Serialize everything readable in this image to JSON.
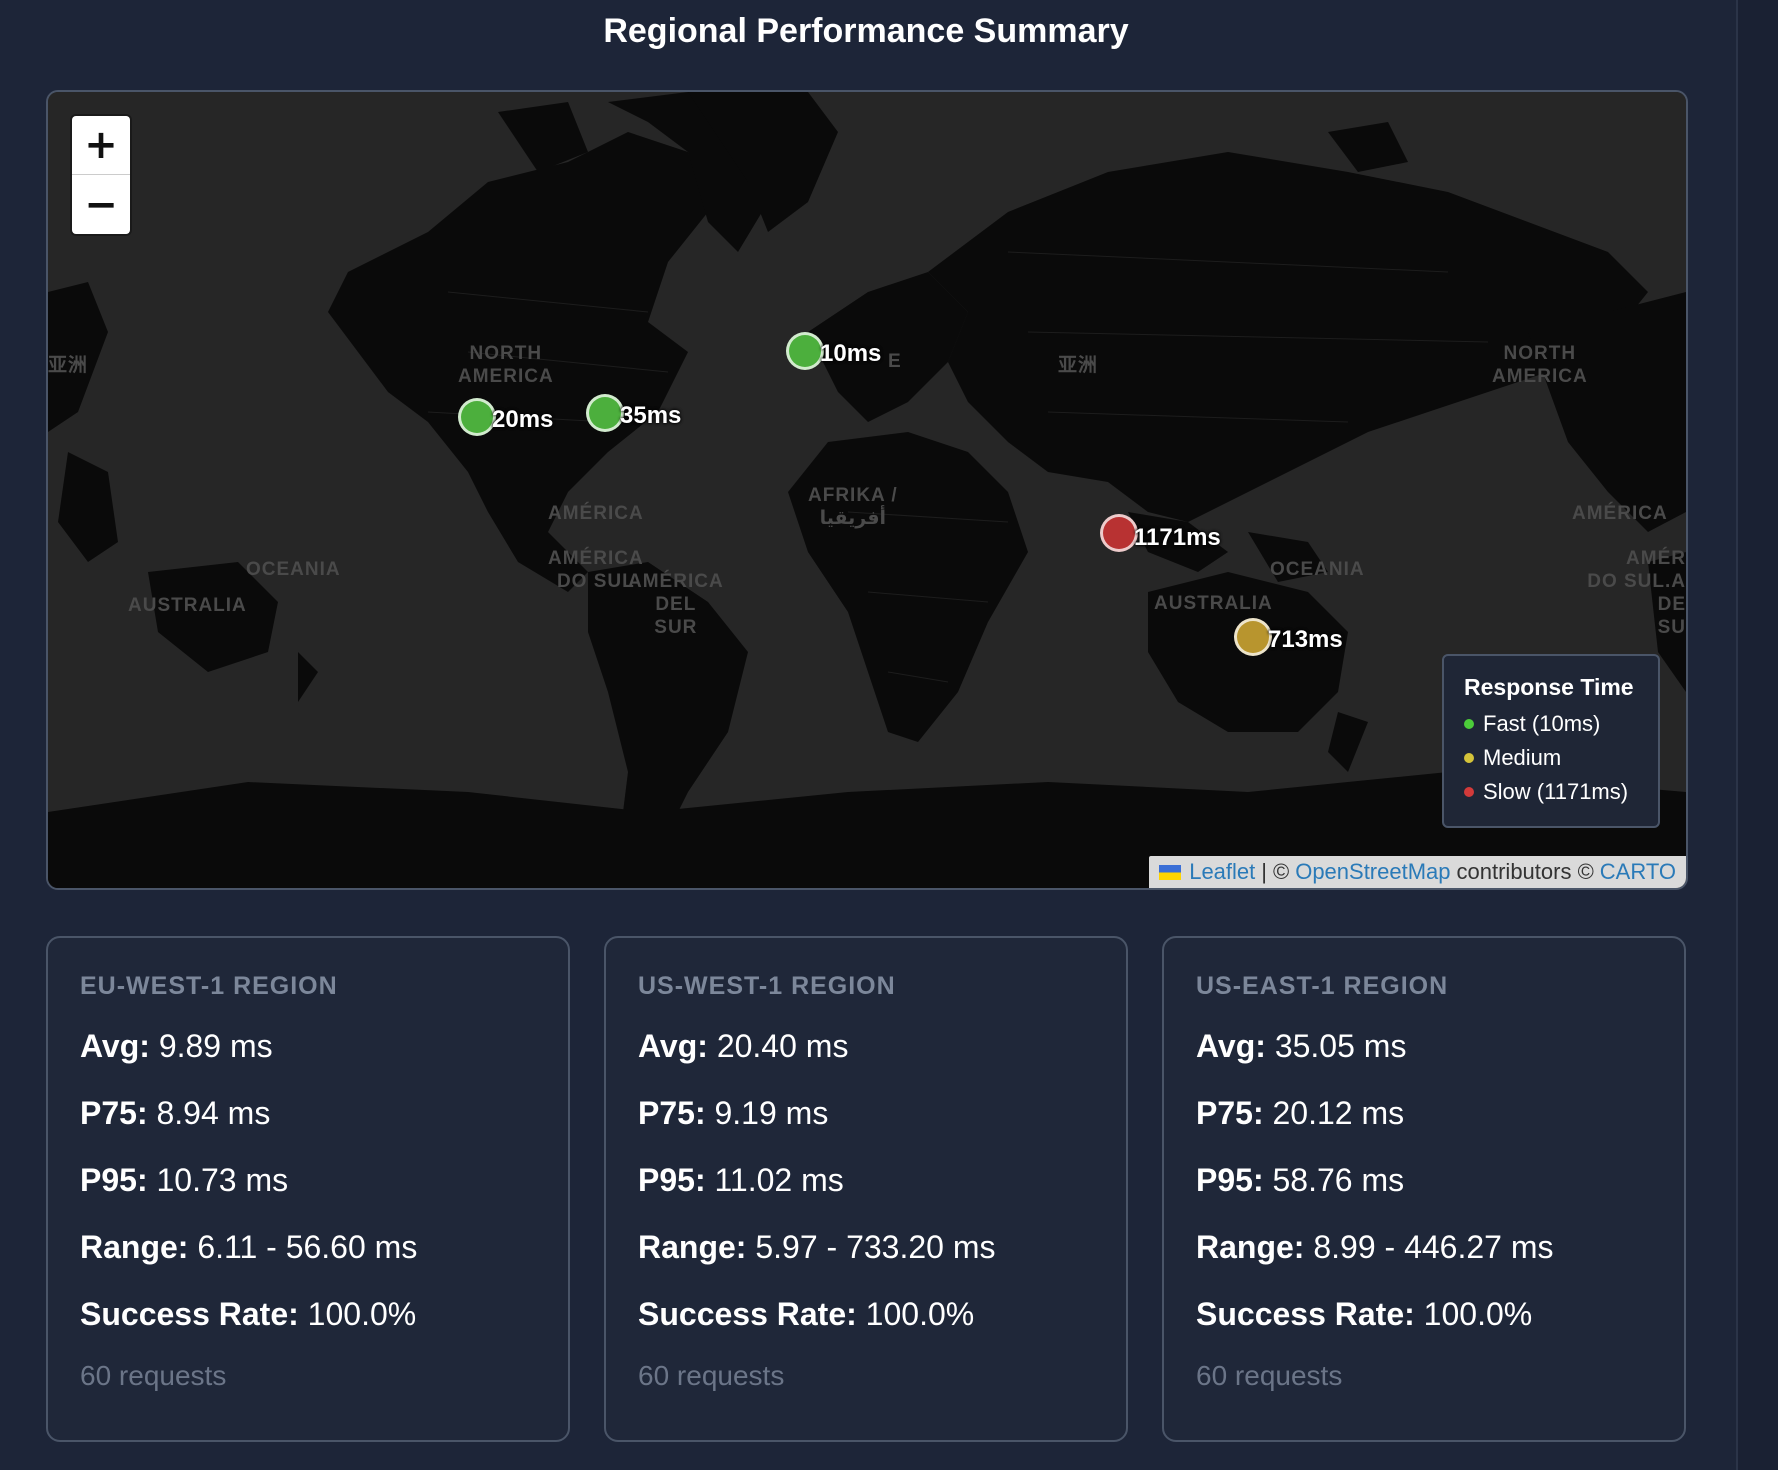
{
  "page": {
    "title": "Regional Performance Summary"
  },
  "map": {
    "zoom_in_label": "+",
    "zoom_out_label": "−",
    "labels": [
      {
        "id": "na-left",
        "text": "NORTH\nAMERICA"
      },
      {
        "id": "asia-left",
        "text": "亚洲"
      },
      {
        "id": "america-left",
        "text": "AMÉRICA"
      },
      {
        "id": "sa-left",
        "text": "AMÉRICA\nDO SUL"
      },
      {
        "id": "sa-left2",
        "text": "AMÉRICA\nDEL\nSUR"
      },
      {
        "id": "oceania-left",
        "text": "OCEANIA"
      },
      {
        "id": "australia-left",
        "text": "AUSTRALIA"
      },
      {
        "id": "africa",
        "text": "AFRIKA /\nأفريقيا"
      },
      {
        "id": "asia",
        "text": "亚洲"
      },
      {
        "id": "oceania",
        "text": "OCEANIA"
      },
      {
        "id": "australia",
        "text": "AUSTRALIA"
      },
      {
        "id": "na-right",
        "text": "NORTH\nAMERICA"
      },
      {
        "id": "america-right",
        "text": "AMÉRICA"
      },
      {
        "id": "sa-right",
        "text": "AMÉR\nDO SUL.A\nDE\nSU"
      },
      {
        "id": "europe-e",
        "text": "E"
      }
    ],
    "markers": [
      {
        "region": "eu-west-1",
        "label": "10ms",
        "status": "fast"
      },
      {
        "region": "us-west-1",
        "label": "20ms",
        "status": "fast"
      },
      {
        "region": "us-east-1",
        "label": "35ms",
        "status": "fast"
      },
      {
        "region": "ap-southeast-1",
        "label": "1171ms",
        "status": "slow"
      },
      {
        "region": "ap-southeast-2",
        "label": "713ms",
        "status": "medium"
      }
    ],
    "colors": {
      "fast": "#4caf3d",
      "medium": "#b8952e",
      "slow": "#b83232",
      "land": "#0a0a0a",
      "water": "#262626"
    },
    "legend": {
      "title": "Response Time",
      "items": [
        {
          "label": "Fast (10ms)",
          "color": "#4ccc3a"
        },
        {
          "label": "Medium",
          "color": "#d4c33a"
        },
        {
          "label": "Slow (1171ms)",
          "color": "#d23a3a"
        }
      ]
    },
    "attribution": {
      "leaflet": "Leaflet",
      "sep": "|",
      "copy1": "©",
      "osm": "OpenStreetMap",
      "contributors": "contributors ©",
      "carto": "CARTO"
    }
  },
  "cards": [
    {
      "region": "EU-WEST-1 REGION",
      "avg_label": "Avg:",
      "avg": "9.89 ms",
      "p75_label": "P75:",
      "p75": "8.94 ms",
      "p95_label": "P95:",
      "p95": "10.73 ms",
      "range_label": "Range:",
      "range": "6.11 - 56.60 ms",
      "success_label": "Success Rate:",
      "success": "100.0%",
      "requests": "60 requests"
    },
    {
      "region": "US-WEST-1 REGION",
      "avg_label": "Avg:",
      "avg": "20.40 ms",
      "p75_label": "P75:",
      "p75": "9.19 ms",
      "p95_label": "P95:",
      "p95": "11.02 ms",
      "range_label": "Range:",
      "range": "5.97 - 733.20 ms",
      "success_label": "Success Rate:",
      "success": "100.0%",
      "requests": "60 requests"
    },
    {
      "region": "US-EAST-1 REGION",
      "avg_label": "Avg:",
      "avg": "35.05 ms",
      "p75_label": "P75:",
      "p75": "20.12 ms",
      "p95_label": "P95:",
      "p95": "58.76 ms",
      "range_label": "Range:",
      "range": "8.99 - 446.27 ms",
      "success_label": "Success Rate:",
      "success": "100.0%",
      "requests": "60 requests"
    }
  ]
}
